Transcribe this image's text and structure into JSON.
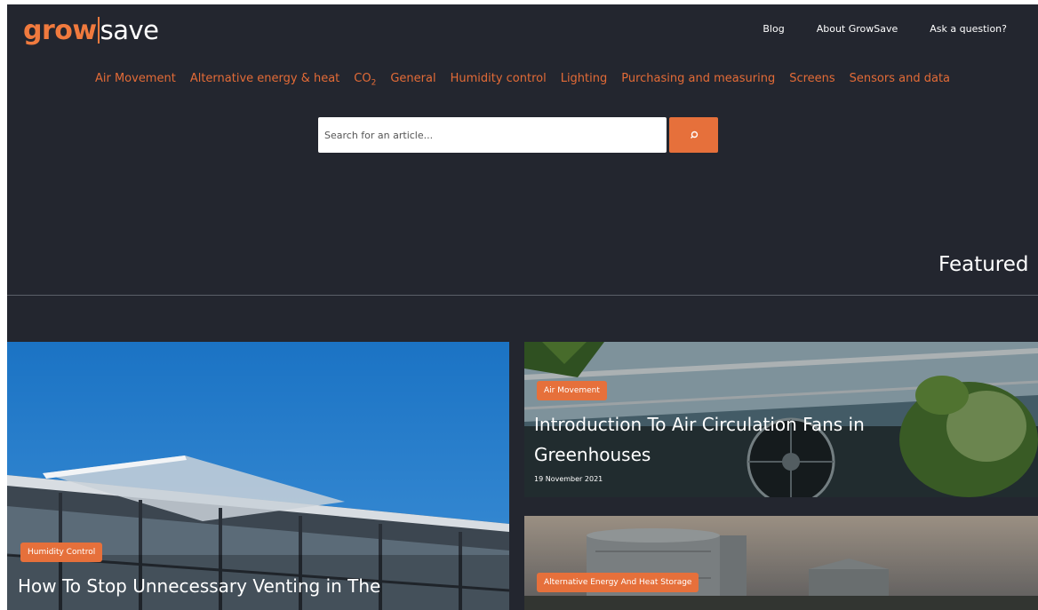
{
  "brand": {
    "grow": "grow",
    "save": "save",
    "accent_color": "#f07a3e",
    "bg_color": "#23262f"
  },
  "top_nav": {
    "blog": "Blog",
    "about": "About GrowSave",
    "ask": "Ask a question?"
  },
  "categories": {
    "air": "Air Movement",
    "energy": "Alternative energy & heat",
    "co2_main": "CO",
    "co2_sub": "2",
    "general": "General",
    "humidity": "Humidity control",
    "lighting": "Lighting",
    "purchasing": "Purchasing and measuring",
    "screens": "Screens",
    "sensors": "Sensors and data"
  },
  "search": {
    "placeholder": "Search for an article...",
    "button_icon": "search-icon"
  },
  "featured": {
    "heading": "Featured"
  },
  "articles": [
    {
      "badge": "Humidity Control",
      "title": "How To Stop Unnecessary Venting in The",
      "date": ""
    },
    {
      "badge": "Air Movement",
      "title_line1": "Introduction To Air Circulation Fans in",
      "title_line2": "Greenhouses",
      "date": "19 November 2021"
    },
    {
      "badge": "Alternative Energy And Heat Storage",
      "title": "",
      "date": ""
    }
  ]
}
